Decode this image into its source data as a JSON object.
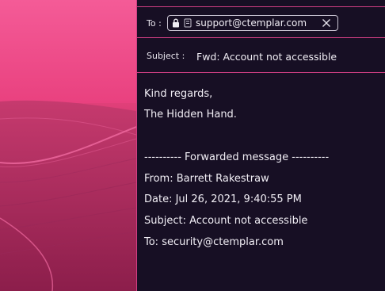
{
  "compose": {
    "to_label": "To :",
    "recipient": "support@ctemplar.com",
    "subject_label": "Subject :",
    "subject_value": "Fwd: Account not accessible"
  },
  "message": {
    "signoff": "Kind regards,",
    "signature": "The Hidden Hand.",
    "forward_header": "---------- Forwarded message ----------",
    "from": "From: Barrett Rakestraw",
    "date": "Date: Jul 26, 2021, 9:40:55 PM",
    "subject": "Subject: Account not accessible",
    "to": "To: security@ctemplar.com"
  },
  "icons": {
    "lock": "lock-icon",
    "contact": "contact-card-icon",
    "remove": "close-icon"
  },
  "colors": {
    "panel_bg": "#170f24",
    "accent_border": "#d23f84",
    "text": "#f1eef5",
    "wallpaper_pink": "#f0508e"
  }
}
